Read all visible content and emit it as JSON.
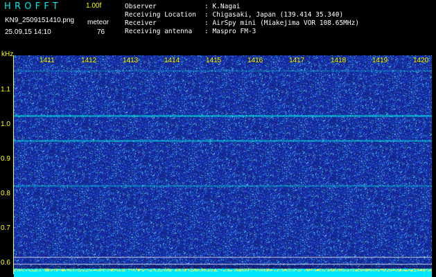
{
  "header": {
    "logo": "HROFFT",
    "version": "1.00f",
    "filename": "KN9_2509151410.png",
    "datetime": "25.09.15 14:10",
    "meteor_label": "meteor",
    "meteor_count": "76"
  },
  "info": [
    {
      "label": "Observer",
      "value": ": K.Nagai"
    },
    {
      "label": "Receiving Location",
      "value": ": Chigasaki, Japan (139.414 35.340)"
    },
    {
      "label": "Receiver",
      "value": ": AirSpy mini (Miakejima VOR 108.65MHz)"
    },
    {
      "label": "Receiving antenna",
      "value": ": Maspro FM-3"
    }
  ],
  "axes": {
    "y_unit": "kHz",
    "y_ticks": [
      "1.1",
      "1.0",
      "0.9",
      "0.8",
      "0.7",
      "0.6"
    ],
    "x_ticks": [
      "1411",
      "1412",
      "1413",
      "1414",
      "1415",
      "1416",
      "1417",
      "1418",
      "1419",
      "1420"
    ]
  },
  "colors": {
    "background": "#000000",
    "noise_base": "#1a2a9a",
    "signal": "#00e6e6",
    "axis": "#ffff00",
    "header_text": "#ffffff"
  },
  "spectrogram": {
    "y_range_khz": [
      0.58,
      1.16
    ],
    "lines_khz": [
      {
        "freq": 1.0,
        "strength": 1.0
      },
      {
        "freq": 0.935,
        "strength": 0.8
      },
      {
        "freq": 0.815,
        "strength": 0.55
      },
      {
        "freq": 1.12,
        "strength": 0.35
      }
    ]
  }
}
